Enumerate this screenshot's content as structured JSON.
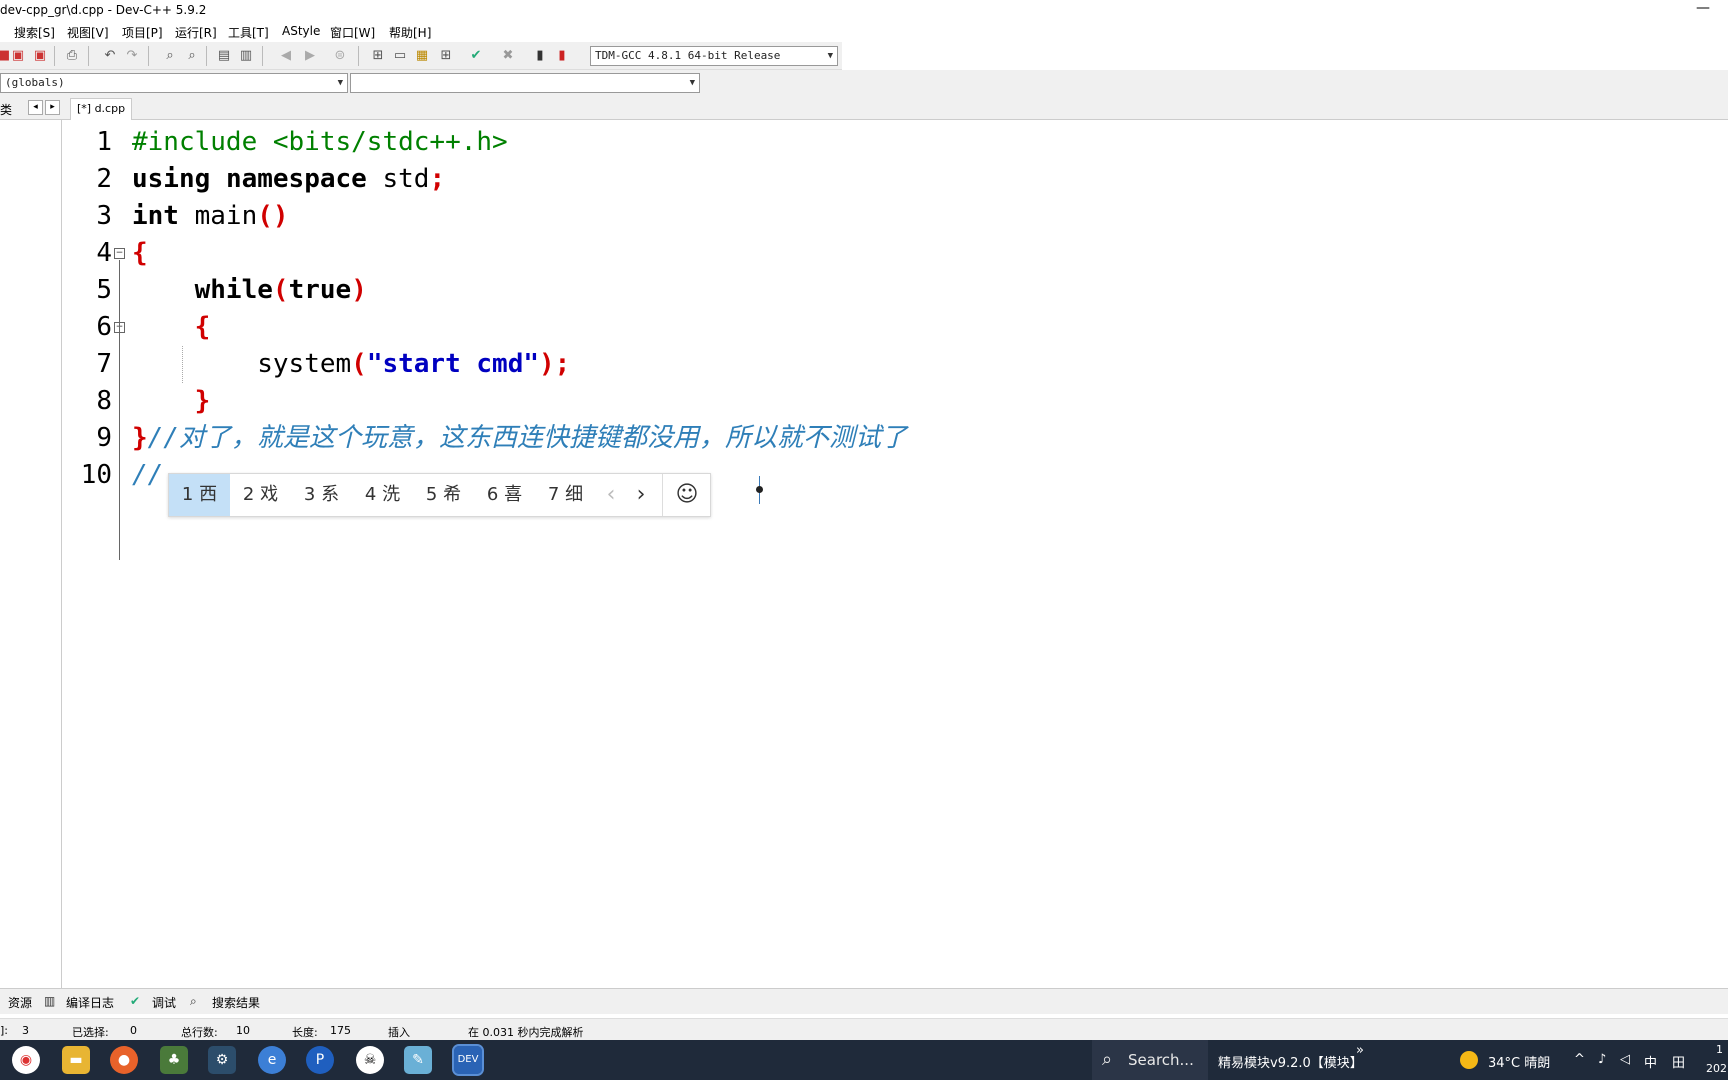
{
  "window": {
    "title": "dev-cpp_gr\\d.cpp - Dev-C++ 5.9.2",
    "minimize": "—"
  },
  "menu": [
    {
      "label": "搜索[S]"
    },
    {
      "label": "视图[V]"
    },
    {
      "label": "项目[P]"
    },
    {
      "label": "运行[R]"
    },
    {
      "label": "工具[T]"
    },
    {
      "label": "AStyle"
    },
    {
      "label": "窗口[W]"
    },
    {
      "label": "帮助[H]"
    }
  ],
  "toolbar": {
    "compiler": "TDM-GCC 4.8.1 64-bit Release"
  },
  "classbar": {
    "scope": "(globals)",
    "function": ""
  },
  "tabs": {
    "left_label": "类",
    "file_tab": "[*] d.cpp"
  },
  "editor": {
    "line_numbers": [
      "1",
      "2",
      "3",
      "4",
      "5",
      "6",
      "7",
      "8",
      "9",
      "10"
    ],
    "line1": "#include <bits/stdc++.h>",
    "line2_kw1": "using",
    "line2_kw2": "namespace",
    "line2_rest": " std",
    "line2_semi": ";",
    "line3_kw": "int",
    "line3_rest": " main",
    "line3_paren": "()",
    "line4": "{",
    "line5_kw": "while",
    "line5_open": "(",
    "line5_true": "true",
    "line5_close": ")",
    "line6": "{",
    "line7_fn": "system",
    "line7_open": "(",
    "line7_str": "\"start cmd\"",
    "line7_close": ");",
    "line8": "}",
    "line9_brace": "}",
    "line9_comment": "//对了，就是这个玩意，这东西连快捷键都没用，所以就不测试了",
    "line10": "//"
  },
  "ime": {
    "candidates": [
      "1 西",
      "2 戏",
      "3 系",
      "4 洗",
      "5 希",
      "6 喜",
      "7 细"
    ],
    "prev": "‹",
    "next": "›",
    "emoji": "☺"
  },
  "bottom_tabs": [
    "资源",
    "编译日志",
    "调试",
    "搜索结果"
  ],
  "status": {
    "row_label": "]:",
    "row": "3",
    "selected_label": "已选择:",
    "selected": "0",
    "total_label": "总行数:",
    "total": "10",
    "length_label": "长度:",
    "length": "175",
    "mode": "插入",
    "parse": "在 0.031 秒内完成解析"
  },
  "taskbar": {
    "search": "Search...",
    "app_title": "精易模块v9.2.0【模块】",
    "more": "»",
    "weather": "34°C 晴朗",
    "ime_lang": "中",
    "clock_top": "1",
    "clock_bottom": "202"
  }
}
